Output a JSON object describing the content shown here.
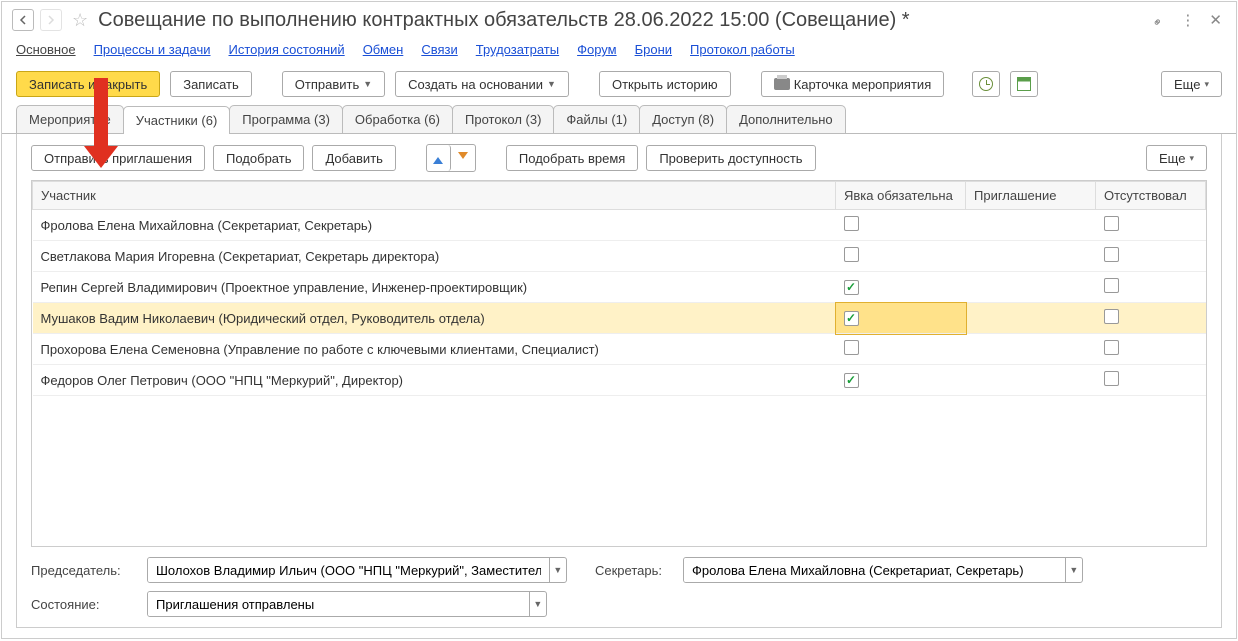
{
  "title": "Совещание по выполнению контрактных обязательств 28.06.2022 15:00 (Совещание) *",
  "nav": [
    "Основное",
    "Процессы и задачи",
    "История состояний",
    "Обмен",
    "Связи",
    "Трудозатраты",
    "Форум",
    "Брони",
    "Протокол работы"
  ],
  "toolbar": {
    "save_close": "Записать и закрыть",
    "save": "Записать",
    "send": "Отправить",
    "create_from": "Создать на основании",
    "open_history": "Открыть историю",
    "event_card": "Карточка мероприятия",
    "more": "Еще"
  },
  "tabs": [
    {
      "label": "Мероприятие"
    },
    {
      "label": "Участники (6)"
    },
    {
      "label": "Программа (3)"
    },
    {
      "label": "Обработка (6)"
    },
    {
      "label": "Протокол (3)"
    },
    {
      "label": "Файлы (1)"
    },
    {
      "label": "Доступ (8)"
    },
    {
      "label": "Дополнительно"
    }
  ],
  "active_tab": 1,
  "content_toolbar": {
    "send_invites": "Отправить приглашения",
    "pick": "Подобрать",
    "add": "Добавить",
    "pick_time": "Подобрать время",
    "check_avail": "Проверить доступность",
    "more": "Еще"
  },
  "columns": {
    "participant": "Участник",
    "required": "Явка обязательна",
    "invite": "Приглашение",
    "absent": "Отсутствовал"
  },
  "rows": [
    {
      "name": "Фролова Елена Михайловна (Секретариат, Секретарь)",
      "required": false,
      "invite": "",
      "absent": false
    },
    {
      "name": "Светлакова Мария Игоревна (Секретариат, Секретарь директора)",
      "required": false,
      "invite": "",
      "absent": false
    },
    {
      "name": "Репин Сергей Владимирович (Проектное управление, Инженер-проектировщик)",
      "required": true,
      "invite": "",
      "absent": false
    },
    {
      "name": "Мушаков Вадим Николаевич (Юридический отдел, Руководитель отдела)",
      "required": true,
      "invite": "",
      "absent": false,
      "selected": true
    },
    {
      "name": "Прохорова Елена Семеновна (Управление по работе с ключевыми клиентами, Специалист)",
      "required": false,
      "invite": "",
      "absent": false
    },
    {
      "name": "Федоров Олег Петрович (ООО \"НПЦ \"Меркурий\", Директор)",
      "required": true,
      "invite": "",
      "absent": false
    }
  ],
  "form": {
    "chair_label": "Председатель:",
    "chair_value": "Шолохов Владимир Ильич (ООО \"НПЦ \"Меркурий\", Заместитель",
    "sec_label": "Секретарь:",
    "sec_value": "Фролова Елена Михайловна (Секретариат, Секретарь)",
    "state_label": "Состояние:",
    "state_value": "Приглашения отправлены"
  }
}
